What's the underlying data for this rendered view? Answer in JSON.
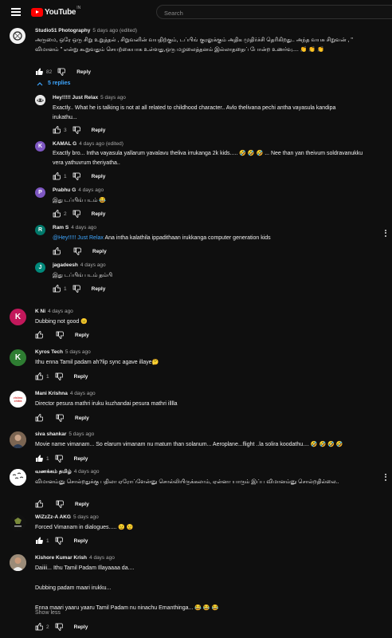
{
  "header": {
    "brand": "YouTube",
    "country": "IN",
    "search_placeholder": "Search"
  },
  "colors": {
    "link": "#3ea6ff",
    "brand_red": "#ff0000",
    "background": "#0f0f0f"
  },
  "main_comment": {
    "author": "Studio51 Photography",
    "time": "5 days ago (edited)",
    "text": "அருமை, ஒரே ஒரு சிறு உறுத்தல் , சிறுவனின் வயதிற்கும், டப்பிங் குரலுக்கும் அதிக முதிர்ச்சி தெரிகிறது.. அந்த வயசு சிறுவன் , \" விமானம் \" என்று கூறுவதும் செயற்கையாக உள்ளது,ஒரு மழலைத்தனம் இல்லாததைப் போன்ற உணர்வு.... 👏 👏 👏",
    "likes": "82",
    "reply_label": "Reply",
    "replies_toggle": "5 replies"
  },
  "replies": [
    {
      "author": "Hey!!!!! Just Relax",
      "time": "5 days ago",
      "text": "Exactly.. What he is talking is not at all related to childhood character.. Avlo thelivana pechi antha vayasula kandipa irukathu...",
      "likes": "3",
      "reply_label": "Reply",
      "icon": "raccoon-avatar-icon"
    },
    {
      "author": "KAMAL G",
      "time": "4 days ago (edited)",
      "text": "Exactly bro... Intha vayasula yallarum yavalavu theliva irrukanga 2k kids..... 🤣 🤣 🤣 ... Nee than yan theivum soldravanukku vera yathuvrum theriyatha..",
      "likes": "1",
      "reply_label": "Reply",
      "initial": "K"
    },
    {
      "author": "Prabhu G",
      "time": "4 days ago",
      "text": "இது டப்பிங் படம் 😂",
      "likes": "2",
      "reply_label": "Reply",
      "initial": "P"
    },
    {
      "author": "Ram S",
      "time": "4 days ago",
      "mention": "@Hey!!!!! Just Relax",
      "text": " Ana intha kalathila ippadithaan irukkanga computer generation kids",
      "likes": "",
      "reply_label": "Reply",
      "initial": "R"
    },
    {
      "author": "jagadeesh",
      "time": "4 days ago",
      "text": "இது டப்பிங் படம் தம்பி",
      "likes": "1",
      "reply_label": "Reply",
      "initial": "J"
    }
  ],
  "comments": [
    {
      "author": "K Ni",
      "time": "4 days ago",
      "text": "Dubbing not good 😐",
      "likes": "",
      "reply_label": "Reply",
      "initial": "K"
    },
    {
      "author": "Kyros Tech",
      "time": "5 days ago",
      "text": "Ithu enna Tamil padam ah?lip sync agave illaye🤔",
      "likes": "1",
      "reply_label": "Reply",
      "initial": "K"
    },
    {
      "author": "Mani Krishna",
      "time": "4 days ago",
      "text": "Director pesura mathri iruku kuzhandai pesura mathri illlla",
      "likes": "",
      "reply_label": "Reply",
      "icon": "vishnu-chitra-logo-icon",
      "logo_text": "vishnu chitra"
    },
    {
      "author": "siva shankar",
      "time": "5 days ago",
      "text": "Movie name vimanam... So elarum vimanam nu matum than solanum... Aeroplane...flight ..la solira koodathu.... 🤣 🤣 🤣 🤣",
      "likes": "1",
      "reply_label": "Reply",
      "icon": "person-photo-avatar-icon"
    },
    {
      "author": "வணக்கம் தமிழ்",
      "time": "4 days ago",
      "text": "விமானம்னு சொல்றதுக்கு பதிலா ஏரோப்ளேன்னு சொல்லியிருக்கலாம், ஏன்னா யாரும் இப்ப விமானம்னு சொல்றதில்லை..",
      "likes": "",
      "reply_label": "Reply",
      "icon": "birds-avatar-icon"
    },
    {
      "author": "WiZzZz-A AKG",
      "time": "5 days ago",
      "text": "Forced Vimanam in dialogues..... 😟 😟",
      "likes": "1",
      "reply_label": "Reply",
      "icon": "dark-logo-avatar-icon"
    },
    {
      "author": "Kishore Kumar Krish",
      "time": "4 days ago",
      "text_lines": [
        "Daiiii... Ithu Tamil Padam Illayaaaa da....",
        "",
        "Dubbing padam maari irukku...",
        "",
        "Enna maari yaaru yaaru Tamil Padam nu ninachu Emanthinga... 😂 😂 😂"
      ],
      "show_less": "Show less",
      "likes": "2",
      "reply_label": "Reply",
      "icon": "person-photo-avatar-icon"
    }
  ]
}
